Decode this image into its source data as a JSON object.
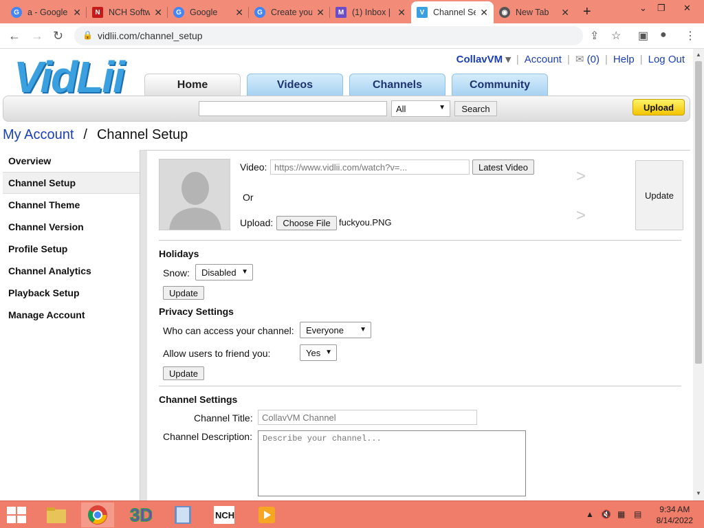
{
  "browser": {
    "tabs": [
      {
        "label": "a - Google",
        "icon": "G",
        "color": "#4285f4"
      },
      {
        "label": "NCH Software",
        "icon": "N",
        "color": "#c41a1a"
      },
      {
        "label": "Google",
        "icon": "G",
        "color": "#4285f4"
      },
      {
        "label": "Create your",
        "icon": "G",
        "color": "#4285f4"
      },
      {
        "label": "(1) Inbox |",
        "icon": "M",
        "color": "#6a4cc7"
      },
      {
        "label": "Channel Setup",
        "icon": "V",
        "color": "#3aa0e0"
      },
      {
        "label": "New Tab",
        "icon": "◉",
        "color": "#555555"
      }
    ],
    "url": "vidlii.com/channel_setup"
  },
  "site": {
    "logo": "VidLii",
    "user": "CollavVM",
    "links": {
      "account": "Account",
      "inbox": "(0)",
      "help": "Help",
      "logout": "Log Out"
    },
    "nav": [
      "Home",
      "Videos",
      "Channels",
      "Community"
    ],
    "search": {
      "select": "All",
      "button": "Search"
    },
    "upload": "Upload"
  },
  "breadcrumb": {
    "parent": "My Account",
    "sep": "/",
    "current": "Channel Setup"
  },
  "sidebar": {
    "items": [
      {
        "label": "Overview"
      },
      {
        "label": "Channel Setup"
      },
      {
        "label": "Channel Theme"
      },
      {
        "label": "Channel Version"
      },
      {
        "label": "Profile Setup"
      },
      {
        "label": "Channel Analytics"
      },
      {
        "label": "Playback Setup"
      },
      {
        "label": "Manage Account"
      }
    ]
  },
  "main": {
    "video_label": "Video:",
    "video_placeholder": "https://www.vidlii.com/watch?v=...",
    "latest_video": "Latest Video",
    "or_label": "Or",
    "upload_label": "Upload:",
    "choose_file": "Choose File",
    "file_name": "fuckyou.PNG",
    "update": "Update",
    "chevron": ">",
    "holidays": {
      "heading": "Holidays",
      "snow_label": "Snow:",
      "snow_value": "Disabled",
      "update": "Update"
    },
    "privacy": {
      "heading": "Privacy Settings",
      "access_label": "Who can access your channel:",
      "access_value": "Everyone",
      "friend_label": "Allow users to friend you:",
      "friend_value": "Yes",
      "update": "Update"
    },
    "channel": {
      "heading": "Channel Settings",
      "title_label": "Channel Title:",
      "title_placeholder": "CollavVM Channel",
      "desc_label": "Channel Description:",
      "desc_placeholder": "Describe your channel..."
    }
  },
  "taskbar": {
    "time": "9:34 AM",
    "date": "8/14/2022"
  }
}
